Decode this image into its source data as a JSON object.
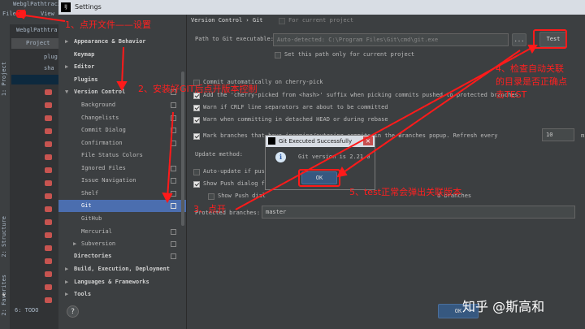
{
  "ide": {
    "project_tab_title": "WebglPathtracin",
    "menu_file": "File",
    "menu_view": "View",
    "project_name": "WebglPathtra",
    "project_panel_label": "Project",
    "tree_item_1": "plug",
    "tree_item_2": "sha",
    "stripe_project": "1: Project",
    "stripe_structure": "2: Structure",
    "stripe_favorites": "2: Favorites",
    "todo_label": "6: TODO"
  },
  "window": {
    "title": "Settings",
    "icon_text": "IJ"
  },
  "settings_tree": {
    "items": [
      {
        "label": "Appearance & Behavior"
      },
      {
        "label": "Keymap"
      },
      {
        "label": "Editor"
      },
      {
        "label": "Plugins"
      },
      {
        "label": "Version Control"
      },
      {
        "label": "Background"
      },
      {
        "label": "Changelists"
      },
      {
        "label": "Commit Dialog"
      },
      {
        "label": "Confirmation"
      },
      {
        "label": "File Status Colors"
      },
      {
        "label": "Ignored Files"
      },
      {
        "label": "Issue Navigation"
      },
      {
        "label": "Shelf"
      },
      {
        "label": "Git"
      },
      {
        "label": "GitHub"
      },
      {
        "label": "Mercurial"
      },
      {
        "label": "Subversion"
      },
      {
        "label": "Directories"
      },
      {
        "label": "Build, Execution, Deployment"
      },
      {
        "label": "Languages & Frameworks"
      },
      {
        "label": "Tools"
      }
    ]
  },
  "panel": {
    "breadcrumb": "Version Control › Git",
    "for_current_project": "For current project",
    "path_label": "Path to Git executable:",
    "path_value": "Auto-detected: C:\\Program Files\\Git\\cmd\\git.exe",
    "browse_label": "...",
    "test_label": "Test",
    "set_path_only": "Set this path only for current project",
    "commit_cherry_pick": "Commit automatically on cherry-pick",
    "add_cherry_suffix": "Add the 'cherry-picked from <hash>' suffix when picking commits pushed to protected branches",
    "warn_crlf": "Warn if CRLF line separators are about to be committed",
    "warn_detached": "Warn when committing in detached HEAD or during rebase",
    "mark_branches": "Mark branches that have incoming/outgoing commits in the Branches popup.  Refresh every",
    "refresh_value": "10",
    "minutes": "minutes",
    "update_method": "Update method:",
    "auto_update": "Auto-update if push",
    "show_push_dialog": "Show Push dialog fo",
    "show_push_dial": "Show Push dial",
    "d_branches": "d branches",
    "protected_label": "Protected branches:",
    "protected_value": "master",
    "ok_main": "OK",
    "help": "?"
  },
  "dialog": {
    "title": "Git Executed Successfully",
    "close": "×",
    "message": "Git version is 2.21.0",
    "ok": "OK",
    "info_glyph": "i"
  },
  "annotations": {
    "step1": "1、点开文件——设置",
    "step2": "2、安装好GIT后点开版本控制",
    "step3": "3、点开",
    "step4_line1": "4、检查自动关联",
    "step4_line2": "的目录是否正确点",
    "step4_line3": "击TEST",
    "step5": "5、test正常会弹出关联版本"
  },
  "watermark": "知乎 @斯高和",
  "colors": {
    "annotation": "#ff2020",
    "selection": "#4b6eaf",
    "background": "#3c3f41"
  }
}
